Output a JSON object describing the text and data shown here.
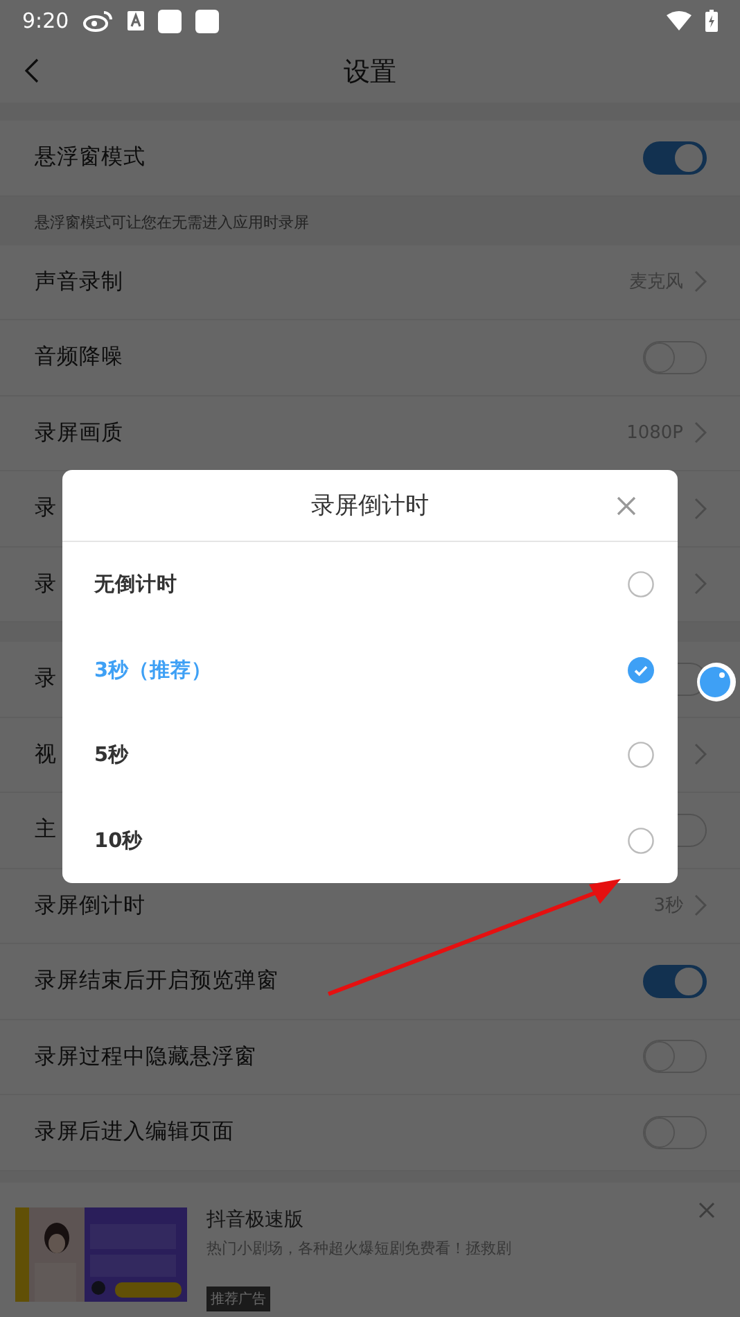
{
  "status_bar": {
    "time": "9:20"
  },
  "header": {
    "title": "设置"
  },
  "groups": [
    {
      "items": [
        {
          "kind": "toggle",
          "label": "悬浮窗模式",
          "on": true
        }
      ],
      "note": "悬浮窗模式可让您在无需进入应用时录屏"
    },
    {
      "items": [
        {
          "kind": "nav",
          "label": "声音录制",
          "value": "麦克风"
        },
        {
          "kind": "toggle",
          "label": "音频降噪",
          "on": false
        },
        {
          "kind": "nav",
          "label": "录屏画质",
          "value": "1080P"
        },
        {
          "kind": "nav",
          "label": "录"
        },
        {
          "kind": "nav",
          "label": "录"
        }
      ]
    },
    {
      "items": [
        {
          "kind": "toggle",
          "label": "录",
          "on": false
        },
        {
          "kind": "nav",
          "label": "视"
        },
        {
          "kind": "toggle",
          "label": "主",
          "on": false
        },
        {
          "kind": "nav",
          "label": "录屏倒计时",
          "value": "3秒"
        },
        {
          "kind": "toggle",
          "label": "录屏结束后开启预览弹窗",
          "on": true
        },
        {
          "kind": "toggle",
          "label": "录屏过程中隐藏悬浮窗",
          "on": false
        },
        {
          "kind": "toggle",
          "label": "录屏后进入编辑页面",
          "on": false
        }
      ]
    }
  ],
  "ad": {
    "title": "抖音极速版",
    "text": "热门小剧场，各种超火爆短剧免费看！拯救剧",
    "tag": "推荐广告"
  },
  "dialog": {
    "title": "录屏倒计时",
    "options": [
      {
        "label": "无倒计时",
        "selected": false
      },
      {
        "label": "3秒（推荐）",
        "selected": true
      },
      {
        "label": "5秒",
        "selected": false
      },
      {
        "label": "10秒",
        "selected": false
      }
    ]
  }
}
